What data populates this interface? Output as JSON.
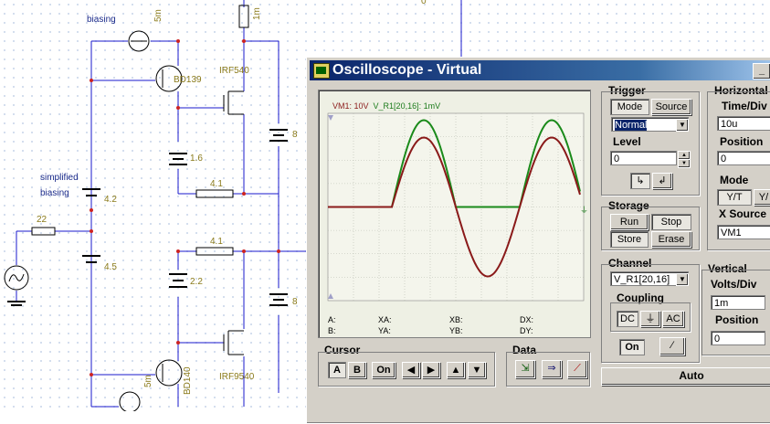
{
  "schematic": {
    "labels": {
      "biasing": "biasing",
      "simplified": "simplified",
      "biasing2": "biasing",
      "current_source_top": "5m",
      "current_source_bot": "5m",
      "top_resistor": "1m",
      "transistor_top": "BD139",
      "transistor_bot": "BD140",
      "mosfet_top": "IRF540",
      "mosfet_bot": "IRF9540",
      "batt_1_6": "1.6",
      "batt_4_2": "4.2",
      "batt_4_5": "4.5",
      "batt_2_2": "2.2",
      "batt_8_top": "8",
      "batt_8_bot": "8",
      "res_22": "22",
      "res_4_1_top": "4.1",
      "res_4_1_bot": "4.1",
      "zero": "0",
      "bottom_35": "35"
    }
  },
  "window": {
    "title": "Oscilloscope - Virtual",
    "minimize": "_"
  },
  "screen": {
    "channel_label": "VM1: 10V",
    "channel2_label": "V_R1[20,16]: 1mV",
    "readouts": {
      "a": "A:",
      "b": "B:",
      "xa": "XA:",
      "ya": "YA:",
      "xb": "XB:",
      "yb": "YB:",
      "dx": "DX:",
      "dy": "DY:"
    },
    "colors": {
      "vm1": "#1a8a1a",
      "vr1": "#8a1a1a",
      "ground": "#1a7a1a"
    }
  },
  "trigger": {
    "title": "Trigger",
    "mode_button": "Mode",
    "source_button": "Source",
    "mode_value": "Normal",
    "level_label": "Level",
    "level_value": "0"
  },
  "storage": {
    "title": "Storage",
    "run": "Run",
    "stop": "Stop",
    "store": "Store",
    "erase": "Erase"
  },
  "channel": {
    "title": "Channel",
    "value": "V_R1[20,16]",
    "coupling_title": "Coupling",
    "dc": "DC",
    "ac": "AC",
    "on": "On"
  },
  "horizontal": {
    "title": "Horizontal",
    "time_div_label": "Time/Div",
    "time_div_value": "10u",
    "position_label": "Position",
    "position_value": "0",
    "mode_label": "Mode",
    "yt": "Y/T",
    "yx": "Y/",
    "x_source_label": "X Source",
    "x_source_value": "VM1"
  },
  "vertical": {
    "title": "Vertical",
    "volts_div_label": "Volts/Div",
    "volts_div_value": "1m",
    "position_label": "Position",
    "position_value": "0"
  },
  "cursor": {
    "title": "Cursor",
    "a": "A",
    "b": "B",
    "on": "On"
  },
  "data": {
    "title": "Data"
  },
  "auto_button": "Auto"
}
